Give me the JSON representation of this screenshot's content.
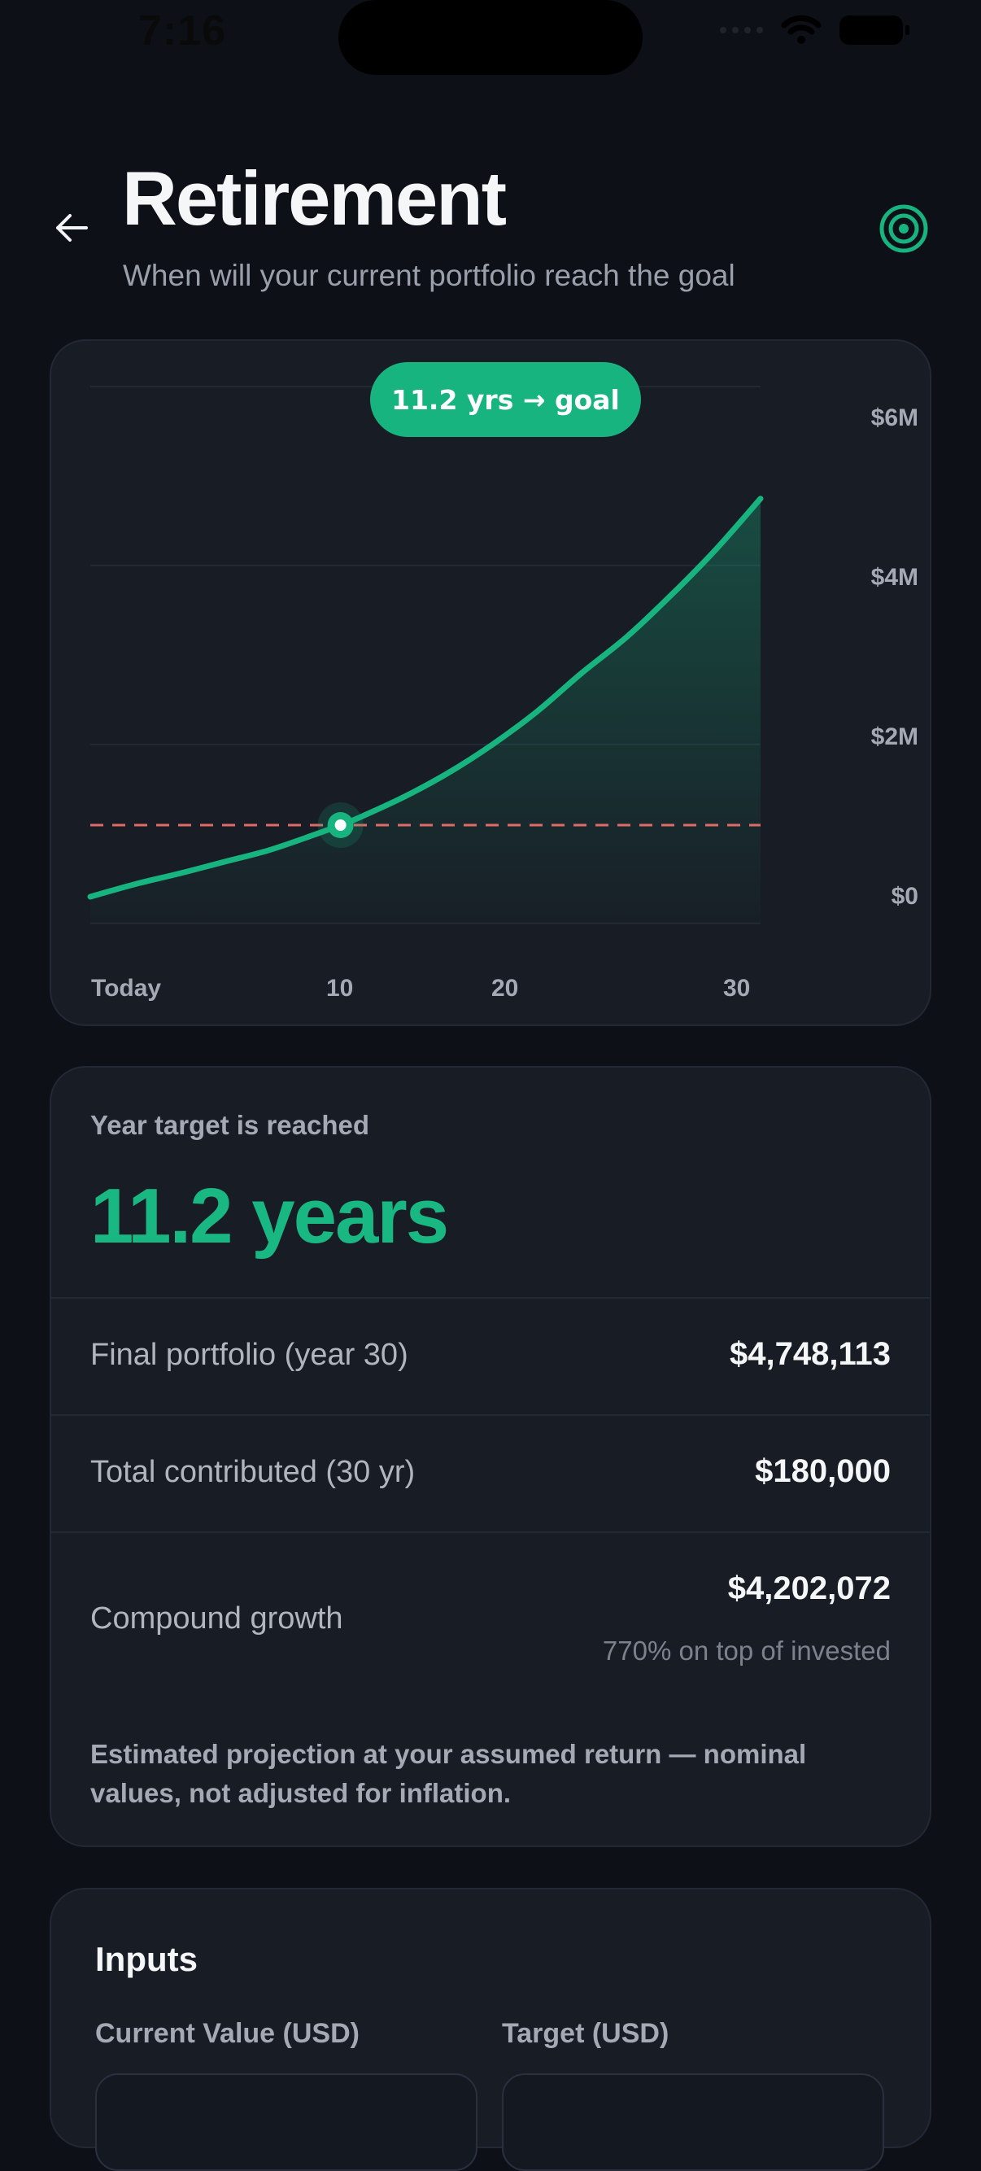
{
  "status_bar": {
    "time": "7:16"
  },
  "header": {
    "title": "Retirement",
    "subtitle": "When will your current portfolio reach the goal",
    "back_icon": "arrow-left-icon",
    "goal_icon": "target-icon"
  },
  "chart": {
    "goal_pill": "11.2 yrs → goal",
    "accent_color": "#17b47f",
    "target_line_color": "#e06a66"
  },
  "chart_data": {
    "type": "area",
    "x_tick_labels": [
      "Today",
      "10",
      "20",
      "30"
    ],
    "y_tick_labels": [
      "$6M",
      "$4M",
      "$2M",
      "$0"
    ],
    "x": [
      0,
      2,
      4,
      6,
      8,
      10,
      11.2,
      12,
      14,
      16,
      18,
      20,
      22,
      24,
      26,
      28,
      30
    ],
    "y": [
      300000,
      440000,
      560000,
      690000,
      820000,
      990000,
      1100000,
      1180000,
      1410000,
      1680000,
      2000000,
      2370000,
      2800000,
      3200000,
      3670000,
      4180000,
      4748113
    ],
    "target_value": 1100000,
    "goal_year": 11.2,
    "xlim": [
      0,
      30
    ],
    "ylim": [
      0,
      6000000
    ],
    "grid": true,
    "legend": "none"
  },
  "summary": {
    "label": "Year target is reached",
    "value": "11.2 years",
    "rows": [
      {
        "label": "Final portfolio (year 30)",
        "value": "$4,748,113"
      },
      {
        "label": "Total contributed (30 yr)",
        "value": "$180,000"
      },
      {
        "label": "Compound growth",
        "value": "$4,202,072",
        "sub": "770% on top of invested"
      }
    ],
    "disclaimer": "Estimated projection at your assumed return — nominal values, not adjusted for inflation."
  },
  "inputs": {
    "title": "Inputs",
    "fields": [
      {
        "label": "Current Value (USD)"
      },
      {
        "label": "Target (USD)"
      }
    ]
  }
}
